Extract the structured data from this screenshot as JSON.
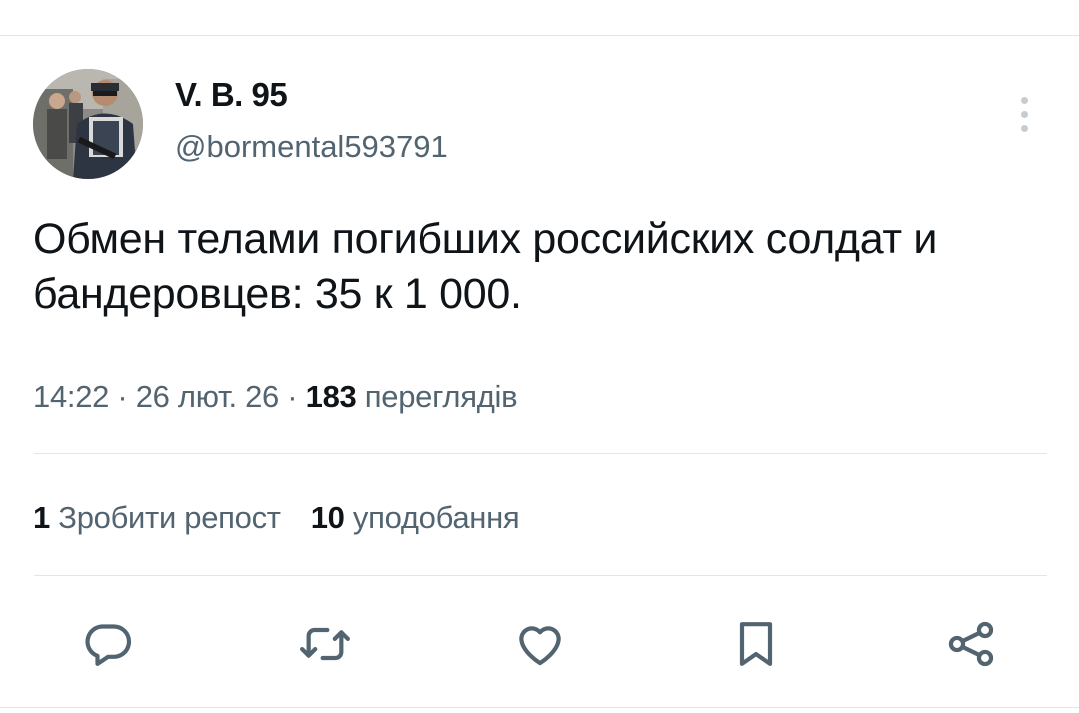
{
  "tweet": {
    "author": {
      "display_name": "V. B. 95",
      "handle": "@bormental593791",
      "avatar": "avatar-photo"
    },
    "text": "Обмен телами погибших российских солдат и бандеровцев: 35 к 1 000.",
    "meta": {
      "time": "14:22",
      "separator": " · ",
      "date": "26 лют. 26",
      "views_count": "183",
      "views_label": "переглядів"
    },
    "stats": {
      "reposts_count": "1",
      "reposts_label": "Зробити репост",
      "likes_count": "10",
      "likes_label": "уподобання"
    },
    "actions": [
      {
        "name": "reply",
        "icon": "reply-icon"
      },
      {
        "name": "repost",
        "icon": "repost-icon"
      },
      {
        "name": "like",
        "icon": "heart-icon"
      },
      {
        "name": "bookmark",
        "icon": "bookmark-icon"
      },
      {
        "name": "share",
        "icon": "share-icon"
      }
    ],
    "more_icon": "more-vertical-icon"
  },
  "colors": {
    "text_primary": "#0f1419",
    "text_secondary": "#536471",
    "divider": "#e1e6ea",
    "icon": "#536471"
  }
}
